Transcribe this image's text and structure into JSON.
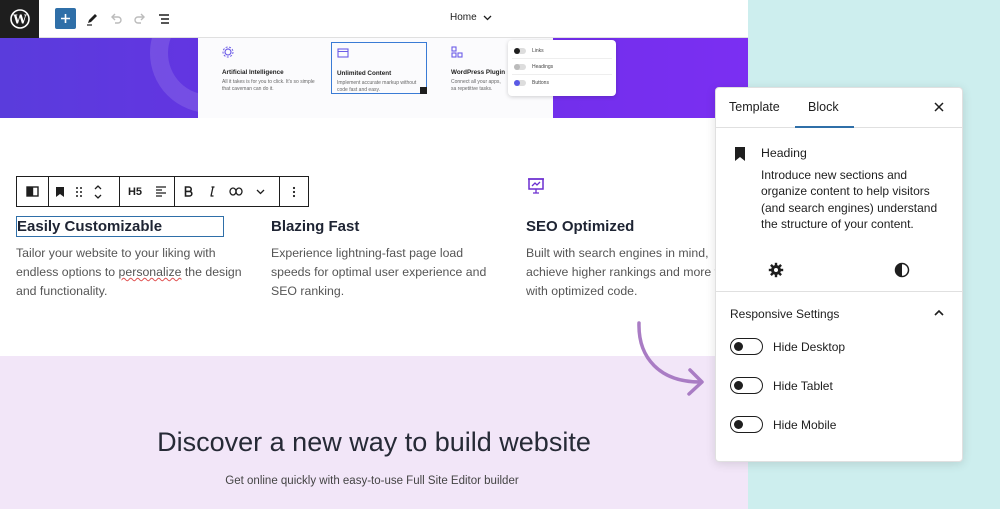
{
  "topbar": {
    "logo_letter": "W",
    "document_title": "Home"
  },
  "hero_card": {
    "items": [
      {
        "title": "Artificial Intelligence",
        "text": "All it takes is for you to click. It's so simple that caveman can do it."
      },
      {
        "title": "Unlimited Content",
        "text": "Implement accurate markup without code fast and easy."
      },
      {
        "title": "WordPress Plugin",
        "text": "Connect all your apps, sa repetitive tasks."
      }
    ],
    "toggles": [
      "Links",
      "Headings",
      "Buttons"
    ]
  },
  "block_toolbar": {
    "heading_level": "H5"
  },
  "features": [
    {
      "title": "Easily Customizable",
      "desc_a": "Tailor your website to your liking with endless options to ",
      "desc_squiggle": "personalize",
      "desc_b": " the design and functionality."
    },
    {
      "title": "Blazing Fast",
      "desc": "Experience lightning-fast page load speeds for optimal user experience and SEO ranking."
    },
    {
      "title": "SEO Optimized",
      "desc": "Built with search engines in mind, achieve higher rankings and more traffic with optimized code."
    }
  ],
  "cta": {
    "title": "Discover a new way to build website",
    "subtitle": "Get online quickly with easy-to-use Full Site Editor builder"
  },
  "panel": {
    "tabs": [
      "Template",
      "Block"
    ],
    "active_tab": "Block",
    "block_name": "Heading",
    "block_description": "Introduce new sections and organize content to help visitors (and search engines) understand the structure of your content.",
    "section_title": "Responsive Settings",
    "toggles": [
      {
        "label": "Hide Desktop",
        "on": false
      },
      {
        "label": "Hide Tablet",
        "on": false
      },
      {
        "label": "Hide Mobile",
        "on": false
      }
    ]
  },
  "colors": {
    "accent": "#2f6fa8",
    "hero_purple": "#6a2fe6",
    "cta_bg": "#f2e6f8",
    "side_bg": "#cdeeee",
    "arrow": "#a97cc4"
  },
  "icons": [
    "wordpress-logo-icon",
    "plus-icon",
    "pencil-icon",
    "undo-icon",
    "redo-icon",
    "list-view-icon",
    "chevron-down-icon",
    "bookmark-icon",
    "drag-handle-icon",
    "move-up-down-icon",
    "align-icon",
    "bold-icon",
    "italic-icon",
    "link-icon",
    "more-options-icon",
    "presentation-chart-icon",
    "close-icon",
    "gear-icon",
    "contrast-icon",
    "chevron-up-icon"
  ]
}
